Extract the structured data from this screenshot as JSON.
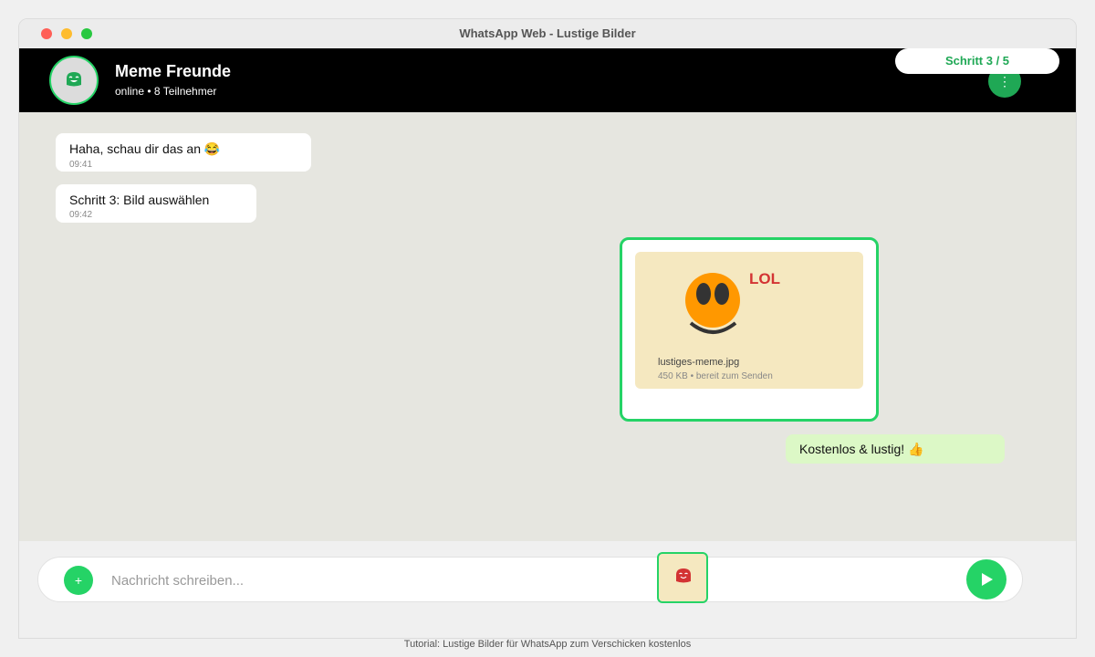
{
  "window": {
    "title": "WhatsApp Web - Lustige Bilder"
  },
  "header": {
    "chat_name": "Meme Freunde",
    "status": "online • 8 Teilnehmer",
    "step_label": "Schritt 3 / 5",
    "menu_glyph": "⋮"
  },
  "messages": [
    {
      "text": "Haha, schau dir das an 😂",
      "time": "09:41",
      "direction": "incoming"
    },
    {
      "text": "Schritt 3: Bild auswählen",
      "time": "09:42",
      "direction": "incoming"
    }
  ],
  "media": {
    "image_text": "LOL",
    "file_name": "lustiges-meme.jpg",
    "file_meta": "450 KB • bereit zum Senden"
  },
  "outgoing": {
    "text": "Kostenlos & lustig! 👍"
  },
  "composer": {
    "attach_glyph": "+",
    "placeholder": "Nachricht schreiben..."
  },
  "caption": "Tutorial: Lustige Bilder für WhatsApp zum Verschicken kostenlos",
  "colors": {
    "accent": "#25d366",
    "header_bg": "#000000",
    "chat_bg": "#e6e6e0",
    "outgoing_bubble": "#dcf8c6",
    "media_bg": "#f5e8c0",
    "lol_red": "#d33333"
  },
  "icons": {
    "avatar": "laughing-face-icon",
    "menu": "more-vertical-icon",
    "attach": "plus-icon",
    "sticker": "sticker-icon",
    "send": "send-icon",
    "meme": "smiley-meme-icon"
  }
}
